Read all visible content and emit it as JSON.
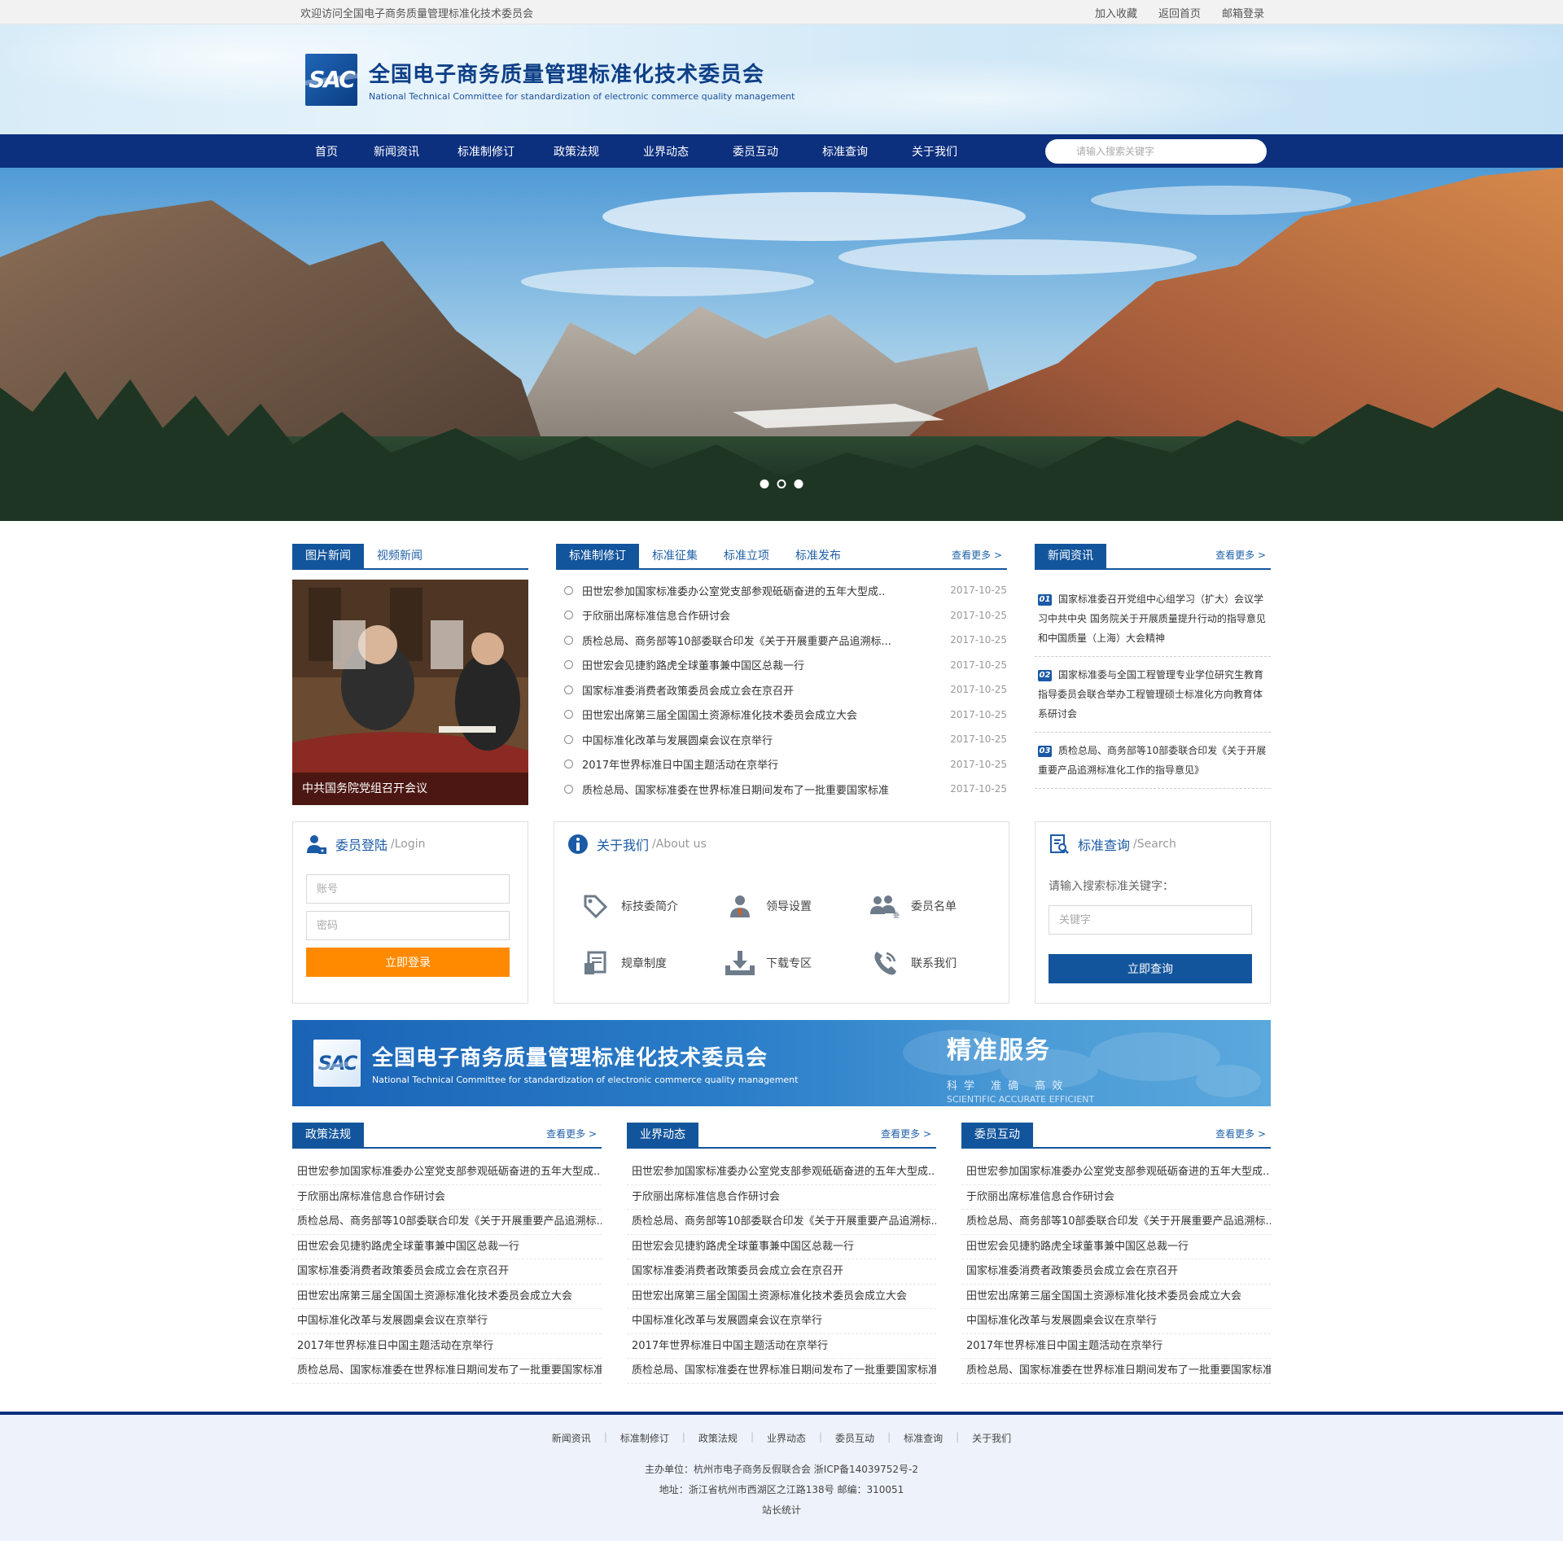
{
  "topbar": {
    "welcome": "欢迎访问全国电子商务质量管理标准化技术委员会",
    "links": [
      "加入收藏",
      "返回首页",
      "邮箱登录"
    ]
  },
  "header": {
    "logo_mark": "SAC",
    "title_cn": "全国电子商务质量管理标准化技术委员会",
    "title_en": "National Technical Committee for standardization of electronic commerce quality management"
  },
  "nav": {
    "items": [
      "首页",
      "新闻资讯",
      "标准制修订",
      "政策法规",
      "业界动态",
      "委员互动",
      "标准查询",
      "关于我们"
    ],
    "search_placeholder": "请输入搜索关键字"
  },
  "banner": {
    "slides": 3,
    "active_slide": 2
  },
  "photo_news": {
    "tabs": [
      "图片新闻",
      "视频新闻"
    ],
    "caption": "中共国务院党组召开会议"
  },
  "standards": {
    "tabs": [
      "标准制修订",
      "标准征集",
      "标准立项",
      "标准发布"
    ],
    "more": "查看更多 >",
    "items": [
      {
        "title": "田世宏参加国家标准委办公室党支部参观砥砺奋进的五年大型成..",
        "date": "2017-10-25"
      },
      {
        "title": "于欣丽出席标准信息合作研讨会",
        "date": "2017-10-25"
      },
      {
        "title": "质检总局、商务部等10部委联合印发《关于开展重要产品追溯标...",
        "date": "2017-10-25"
      },
      {
        "title": "田世宏会见捷豹路虎全球董事兼中国区总裁一行",
        "date": "2017-10-25"
      },
      {
        "title": "国家标准委消费者政策委员会成立会在京召开",
        "date": "2017-10-25"
      },
      {
        "title": "田世宏出席第三届全国国土资源标准化技术委员会成立大会",
        "date": "2017-10-25"
      },
      {
        "title": "中国标准化改革与发展圆桌会议在京举行",
        "date": "2017-10-25"
      },
      {
        "title": "2017年世界标准日中国主题活动在京举行",
        "date": "2017-10-25"
      },
      {
        "title": "质检总局、国家标准委在世界标准日期间发布了一批重要国家标准",
        "date": "2017-10-25"
      }
    ]
  },
  "news": {
    "tab": "新闻资讯",
    "more": "查看更多 >",
    "items": [
      {
        "num": "01",
        "text": "国家标准委召开党组中心组学习（扩大）会议学习中共中央 国务院关于开展质量提升行动的指导意见和中国质量（上海）大会精神"
      },
      {
        "num": "02",
        "text": "国家标准委与全国工程管理专业学位研究生教育指导委员会联合举办工程管理硕士标准化方向教育体系研讨会"
      },
      {
        "num": "03",
        "text": "质检总局、商务部等10部委联合印发《关于开展重要产品追溯标准化工作的指导意见》"
      }
    ]
  },
  "login": {
    "title": "委员登陆",
    "subtitle": "/Login",
    "account_placeholder": "账号",
    "password_placeholder": "密码",
    "button": "立即登录"
  },
  "about": {
    "title": "关于我们",
    "subtitle": "/About us",
    "items": [
      {
        "label": "标技委简介",
        "icon": "tag-icon"
      },
      {
        "label": "领导设置",
        "icon": "leader-icon"
      },
      {
        "label": "委员名单",
        "icon": "members-icon"
      },
      {
        "label": "规章制度",
        "icon": "rules-icon"
      },
      {
        "label": "下载专区",
        "icon": "download-icon"
      },
      {
        "label": "联系我们",
        "icon": "phone-icon"
      }
    ]
  },
  "search_box": {
    "title": "标准查询",
    "subtitle": "/Search",
    "label": "请输入搜索标准关键字：",
    "placeholder": "关键字",
    "button": "立即查询"
  },
  "promo": {
    "logo_mark": "SAC",
    "title_cn": "全国电子商务质量管理标准化技术委员会",
    "title_en": "National Technical Committee for standardization of electronic commerce quality management",
    "slogan": "精准服务",
    "tagline_cn": "科学 准确 高效",
    "tagline_en": "SCIENTIFIC ACCURATE  EFFICIENT"
  },
  "bottom_columns": [
    {
      "tab": "政策法规",
      "more": "查看更多 >",
      "items": [
        "田世宏参加国家标准委办公室党支部参观砥砺奋进的五年大型成..",
        "于欣丽出席标准信息合作研讨会",
        "质检总局、商务部等10部委联合印发《关于开展重要产品追溯标...",
        "田世宏会见捷豹路虎全球董事兼中国区总裁一行",
        "国家标准委消费者政策委员会成立会在京召开",
        "田世宏出席第三届全国国土资源标准化技术委员会成立大会",
        "中国标准化改革与发展圆桌会议在京举行",
        "2017年世界标准日中国主题活动在京举行",
        "质检总局、国家标准委在世界标准日期间发布了一批重要国家标准"
      ]
    },
    {
      "tab": "业界动态",
      "more": "查看更多 >",
      "items": [
        "田世宏参加国家标准委办公室党支部参观砥砺奋进的五年大型成..",
        "于欣丽出席标准信息合作研讨会",
        "质检总局、商务部等10部委联合印发《关于开展重要产品追溯标...",
        "田世宏会见捷豹路虎全球董事兼中国区总裁一行",
        "国家标准委消费者政策委员会成立会在京召开",
        "田世宏出席第三届全国国土资源标准化技术委员会成立大会",
        "中国标准化改革与发展圆桌会议在京举行",
        "2017年世界标准日中国主题活动在京举行",
        "质检总局、国家标准委在世界标准日期间发布了一批重要国家标准"
      ]
    },
    {
      "tab": "委员互动",
      "more": "查看更多 >",
      "items": [
        "田世宏参加国家标准委办公室党支部参观砥砺奋进的五年大型成..",
        "于欣丽出席标准信息合作研讨会",
        "质检总局、商务部等10部委联合印发《关于开展重要产品追溯标...",
        "田世宏会见捷豹路虎全球董事兼中国区总裁一行",
        "国家标准委消费者政策委员会成立会在京召开",
        "田世宏出席第三届全国国土资源标准化技术委员会成立大会",
        "中国标准化改革与发展圆桌会议在京举行",
        "2017年世界标准日中国主题活动在京举行",
        "质检总局、国家标准委在世界标准日期间发布了一批重要国家标准"
      ]
    }
  ],
  "footer": {
    "links": [
      "新闻资讯",
      "标准制修订",
      "政策法规",
      "业界动态",
      "委员互动",
      "标准查询",
      "关于我们"
    ],
    "host": "主办单位：杭州市电子商务反假联合会 浙ICP备14039752号-2",
    "address": "地址：浙江省杭州市西湖区之江路138号 邮编：310051",
    "stats": "站长统计"
  },
  "colors": {
    "nav_bg": "#0c2f7e",
    "accent_blue": "#13559c",
    "login_button": "#ff8a00"
  }
}
